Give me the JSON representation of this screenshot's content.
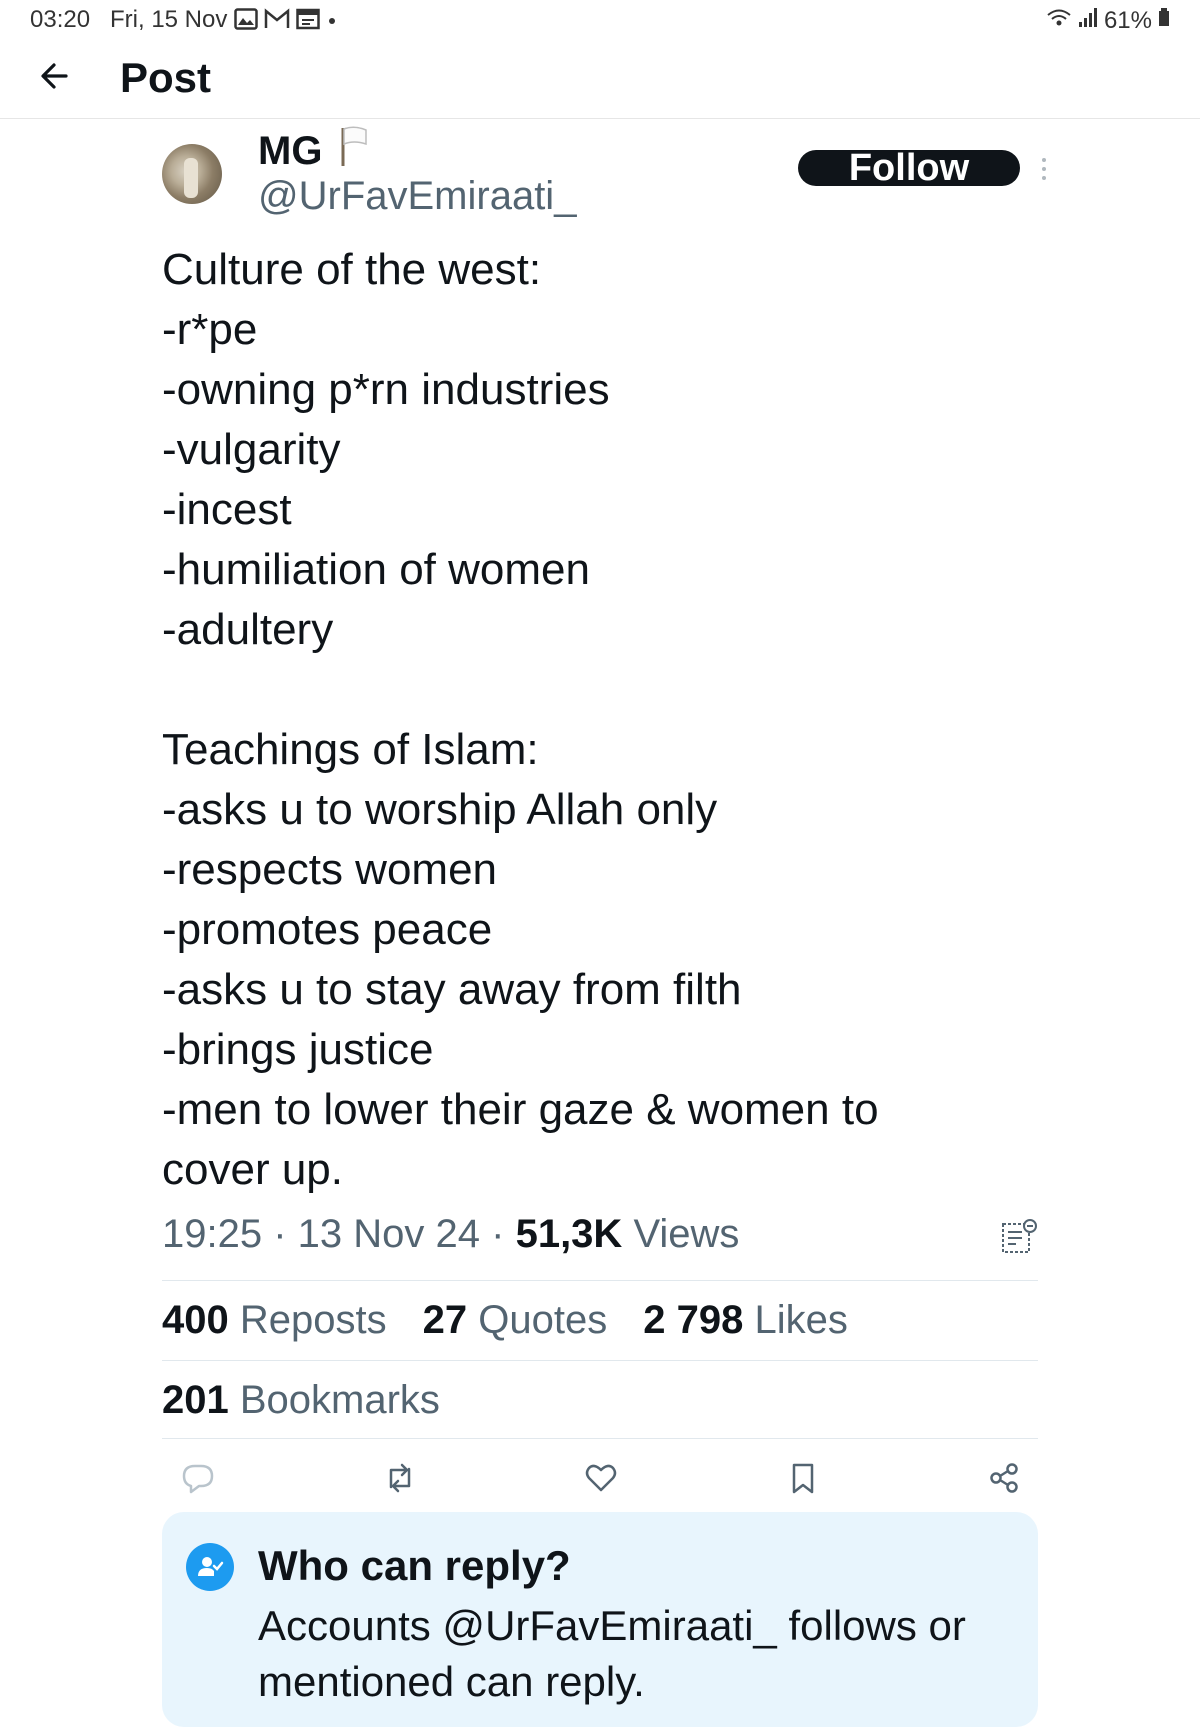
{
  "status_bar": {
    "time": "03:20",
    "date": "Fri, 15 Nov",
    "battery": "61%",
    "notification_icons": [
      "gallery-icon",
      "gmail-icon",
      "calendar-icon",
      "dot-icon"
    ]
  },
  "header": {
    "title": "Post"
  },
  "author": {
    "name": "MG",
    "handle": "@UrFavEmiraati_",
    "follow_label": "Follow"
  },
  "post": {
    "lines": [
      "Culture of the west:",
      "-r*pe",
      "-owning p*rn industries",
      "-vulgarity",
      "-incest",
      "-humiliation of women",
      "-adultery",
      "",
      "Teachings of Islam:",
      "-asks u to worship Allah only",
      "-respects women",
      "-promotes peace",
      "-asks u to stay away from filth",
      "-brings justice",
      "-men to lower their gaze & women to",
      "cover up."
    ],
    "time": "19:25",
    "date": "13 Nov 24",
    "views_count": "51,3K",
    "views_label": "Views"
  },
  "stats": {
    "reposts_count": "400",
    "reposts_label": "Reposts",
    "quotes_count": "27",
    "quotes_label": "Quotes",
    "likes_count": "2 798",
    "likes_label": "Likes",
    "bookmarks_count": "201",
    "bookmarks_label": "Bookmarks"
  },
  "reply_settings": {
    "title": "Who can reply?",
    "text": "Accounts @UrFavEmiraati_ follows or mentioned can reply."
  },
  "colors": {
    "text": "#0f1419",
    "secondary": "#536471",
    "accent": "#1d9bf0",
    "reply_box_bg": "#e8f5fd"
  }
}
